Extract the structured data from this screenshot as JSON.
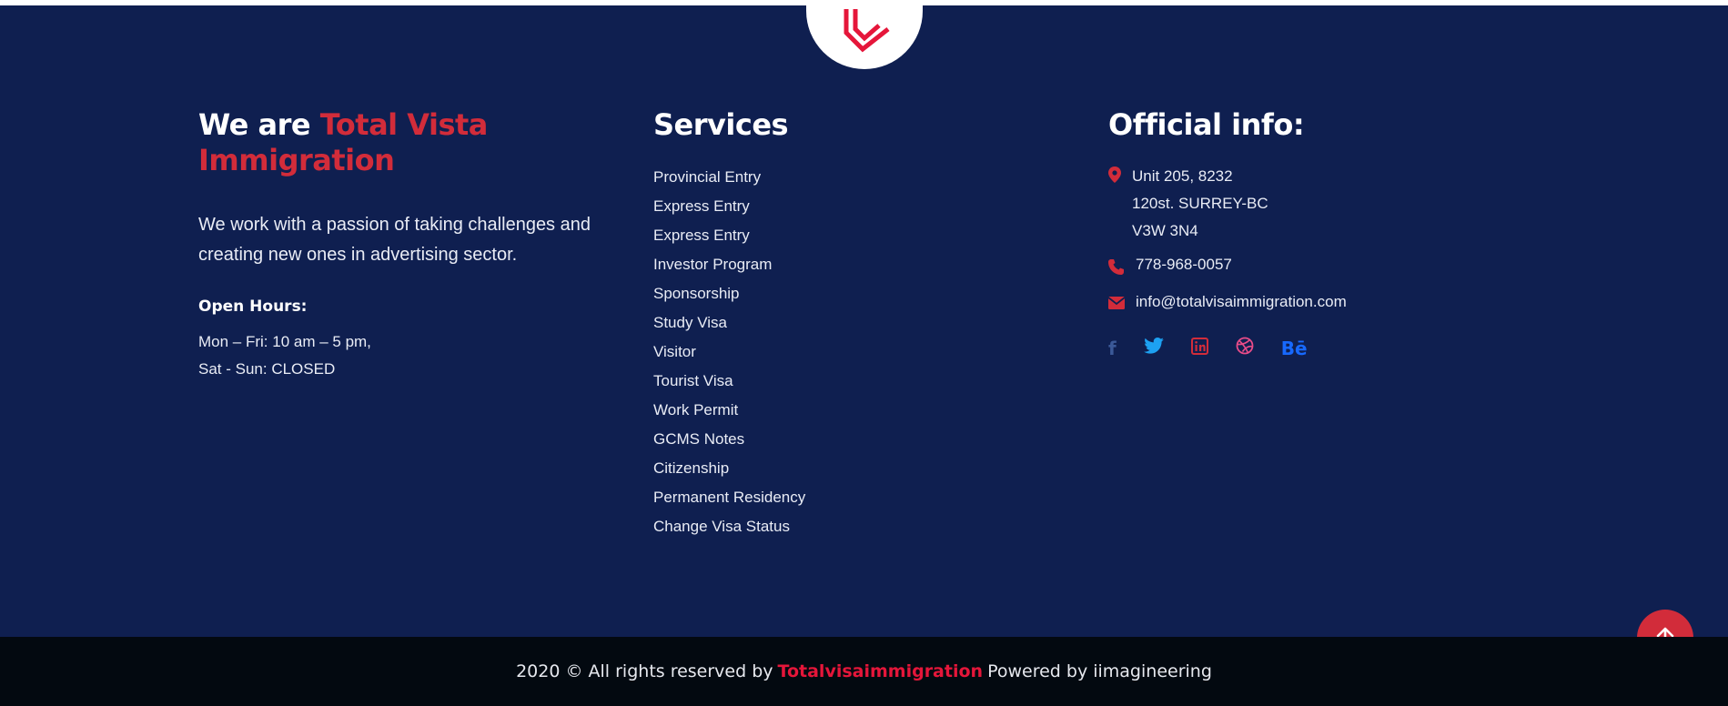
{
  "about": {
    "title_prefix": "We are",
    "title_brand": "Total Vista Immigration",
    "text": "We work with a passion of taking challenges and creating new ones in advertising sector.",
    "hours_label": "Open Hours:",
    "hours_weekday": "Mon – Fri: 10 am – 5 pm,",
    "hours_weekend": "Sat - Sun: CLOSED"
  },
  "services": {
    "title": "Services",
    "items": [
      "Provincial Entry",
      "Express Entry",
      "Express Entry",
      "Investor Program",
      "Sponsorship",
      "Study Visa",
      "Visitor",
      "Tourist Visa",
      "Work Permit",
      "GCMS Notes",
      "Citizenship",
      "Permanent Residency",
      "Change Visa Status"
    ]
  },
  "info": {
    "title": "Official info:",
    "address_line1": "Unit 205, 8232",
    "address_line2": "120st. SURREY-BC",
    "address_line3": "V3W 3N4",
    "phone": "778-968-0057",
    "email": "info@totalvisaimmigration.com",
    "socials": [
      {
        "icon": "facebook-icon",
        "glyph": "f",
        "color": "#3b5998"
      },
      {
        "icon": "twitter-icon",
        "glyph": "🐦",
        "color": "#1da1f2"
      },
      {
        "icon": "linkedin-icon",
        "glyph": "in",
        "color": "#d22c3a"
      },
      {
        "icon": "dribbble-icon",
        "glyph": "◍",
        "color": "#ea4c89"
      },
      {
        "icon": "behance-icon",
        "glyph": "Bē",
        "color": "#1769ff"
      }
    ]
  },
  "copyright": {
    "prefix": "2020 © All rights reserved by",
    "brand": "Totalvisaimmigration",
    "suffix": "Powered by iimagineering"
  },
  "colors": {
    "background": "#0f1f50",
    "accent": "#d22c3a",
    "bottom_bar": "#030910"
  }
}
